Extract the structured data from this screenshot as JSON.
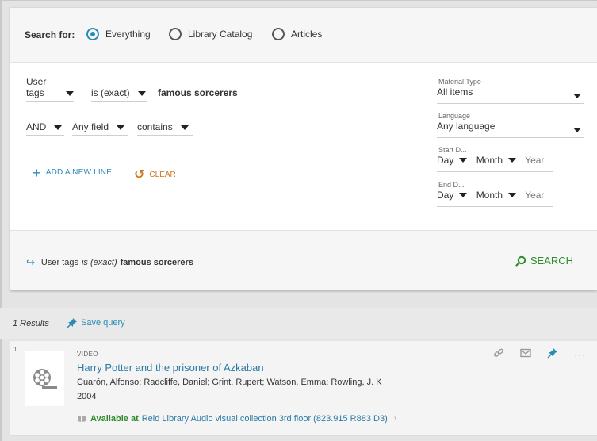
{
  "scope": {
    "label": "Search for:",
    "options": [
      {
        "label": "Everything",
        "selected": true
      },
      {
        "label": "Library Catalog",
        "selected": false
      },
      {
        "label": "Articles",
        "selected": false
      }
    ]
  },
  "query": {
    "line1": {
      "field": "User tags",
      "operator": "is (exact)",
      "value": "famous sorcerers"
    },
    "line2": {
      "boolean": "AND",
      "field": "Any field",
      "operator": "contains",
      "value": ""
    },
    "add_line_label": "ADD A NEW LINE",
    "clear_label": "CLEAR"
  },
  "facets": {
    "material_type": {
      "label": "Material Type",
      "value": "All items"
    },
    "language": {
      "label": "Language",
      "value": "Any language"
    },
    "start_date": {
      "label": "Start D...",
      "day": "Day",
      "month": "Month",
      "year_placeholder": "Year"
    },
    "end_date": {
      "label": "End D...",
      "day": "Day",
      "month": "Month",
      "year_placeholder": "Year"
    }
  },
  "summary": {
    "field": "User tags",
    "operator": "is (exact)",
    "value": "famous sorcerers"
  },
  "search_button": "SEARCH",
  "results": {
    "count_label": "1 Results",
    "save_query_label": "Save query",
    "items": [
      {
        "index": "1",
        "type": "VIDEO",
        "title": "Harry Potter and the prisoner of Azkaban",
        "authors": "Cuarón, Alfonso; Radcliffe, Daniel; Grint, Rupert; Watson, Emma; Rowling, J. K",
        "year": "2004",
        "availability": {
          "status": "Available at",
          "location": "Reid Library  Audio visual collection 3rd floor (823.915 R883 D3)"
        }
      }
    ]
  },
  "colors": {
    "accent": "#2a8bb5",
    "green": "#2e8b2e",
    "orange": "#d0751a"
  }
}
